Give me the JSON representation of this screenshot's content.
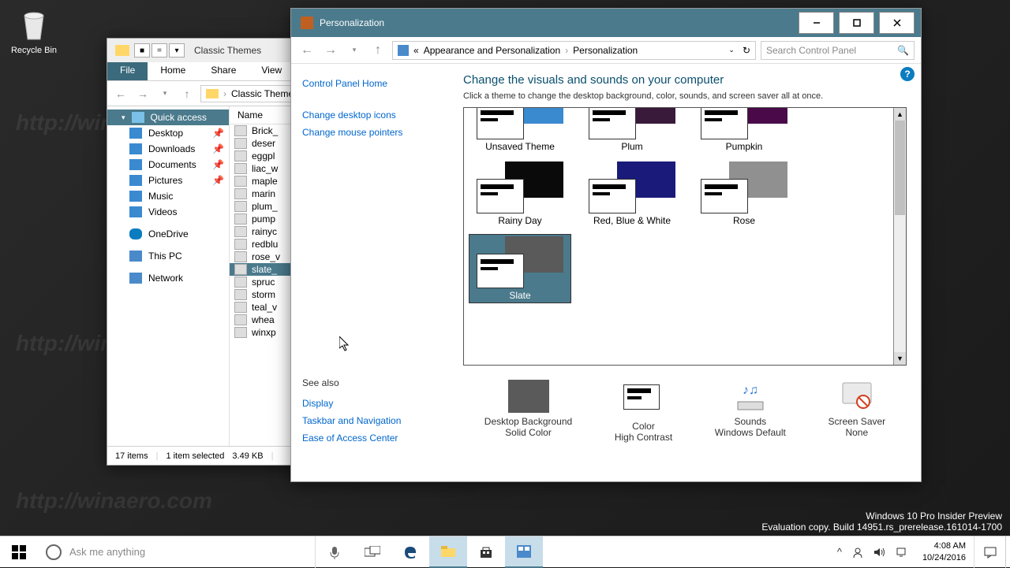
{
  "desktop": {
    "recycle_bin": "Recycle Bin",
    "build_line1": "Windows 10 Pro Insider Preview",
    "build_line2": "Evaluation copy. Build 14951.rs_prerelease.161014-1700"
  },
  "explorer": {
    "title": "Classic Themes",
    "menu": {
      "file": "File",
      "home": "Home",
      "share": "Share",
      "view": "View"
    },
    "breadcrumb": "Classic Themes",
    "sidebar": {
      "quick_access": "Quick access",
      "desktop": "Desktop",
      "downloads": "Downloads",
      "documents": "Documents",
      "pictures": "Pictures",
      "music": "Music",
      "videos": "Videos",
      "onedrive": "OneDrive",
      "this_pc": "This PC",
      "network": "Network"
    },
    "list_header": "Name",
    "files": [
      "Brick_",
      "deser",
      "eggpl",
      "liac_w",
      "maple",
      "marin",
      "plum_",
      "pump",
      "rainyc",
      "redblu",
      "rose_v",
      "slate_",
      "spruc",
      "storm",
      "teal_v",
      "whea",
      "winxp"
    ],
    "selected_file_index": 11,
    "status": {
      "count": "17 items",
      "selected": "1 item selected",
      "size": "3.49 KB"
    }
  },
  "personalization": {
    "title": "Personalization",
    "crumb1": "Appearance and Personalization",
    "crumb2": "Personalization",
    "search_placeholder": "Search Control Panel",
    "sidebar": {
      "home": "Control Panel Home",
      "link1": "Change desktop icons",
      "link2": "Change mouse pointers",
      "seealso": "See also",
      "display": "Display",
      "taskbar": "Taskbar and Navigation",
      "ease": "Ease of Access Center"
    },
    "heading": "Change the visuals and sounds on your computer",
    "subtitle": "Click a theme to change the desktop background, color, sounds, and screen saver all at once.",
    "themes": [
      {
        "name": "Unsaved Theme",
        "bg": "#3a8ad0"
      },
      {
        "name": "Plum",
        "bg": "#3a1a3a"
      },
      {
        "name": "Pumpkin",
        "bg": "#4a0a4a"
      },
      {
        "name": "Rainy Day",
        "bg": "#0a0a0a"
      },
      {
        "name": "Red, Blue & White",
        "bg": "#1a1a7a"
      },
      {
        "name": "Rose",
        "bg": "#909090"
      },
      {
        "name": "Slate",
        "bg": "#5a5a5a"
      }
    ],
    "selected_theme_index": 6,
    "settings": {
      "bg_label": "Desktop Background",
      "bg_value": "Solid Color",
      "color_label": "Color",
      "color_value": "High Contrast",
      "sounds_label": "Sounds",
      "sounds_value": "Windows Default",
      "saver_label": "Screen Saver",
      "saver_value": "None"
    }
  },
  "taskbar": {
    "search_placeholder": "Ask me anything",
    "time": "4:08 AM",
    "date": "10/24/2016"
  }
}
